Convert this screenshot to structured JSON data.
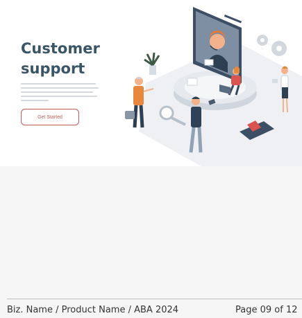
{
  "slide": {
    "title": "Customer support",
    "cta_label": "Get Started"
  },
  "footer": {
    "left_text": "Biz. Name / Product Name / ABA 2024",
    "right_text": "Page 09 of 12"
  },
  "colors": {
    "title": "#3a5566",
    "accent": "#c95a5a",
    "background": "#ffffff"
  },
  "icons": [
    "headset-agent",
    "gear",
    "magnifier",
    "plant",
    "laptop",
    "briefcase"
  ]
}
